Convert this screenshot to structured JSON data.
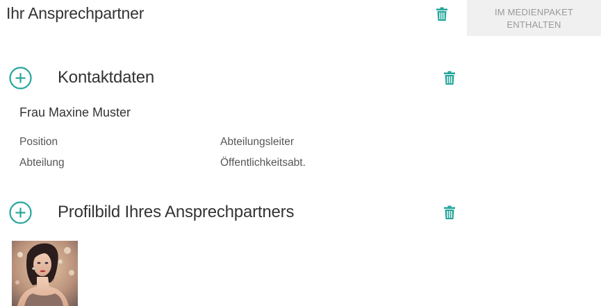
{
  "header": {
    "title": "Ihr Ansprechpartner",
    "badge_text": "IM MEDIENPAKET\nENTHALTEN"
  },
  "sections": {
    "contact": {
      "title": "Kontaktdaten",
      "name": "Frau Maxine Muster",
      "fields": [
        {
          "label": "Position",
          "value": "Abteilungsleiter"
        },
        {
          "label": "Abteilung",
          "value": "Öffentlichkeitsabt."
        }
      ]
    },
    "profile": {
      "title": "Profilbild Ihres Ansprechpartners"
    }
  },
  "icons": {
    "delete": "trash-icon",
    "add": "plus-circle-icon"
  },
  "colors": {
    "accent": "#26a69a",
    "badge_bg": "#f0f0f0",
    "badge_text": "#999999"
  }
}
